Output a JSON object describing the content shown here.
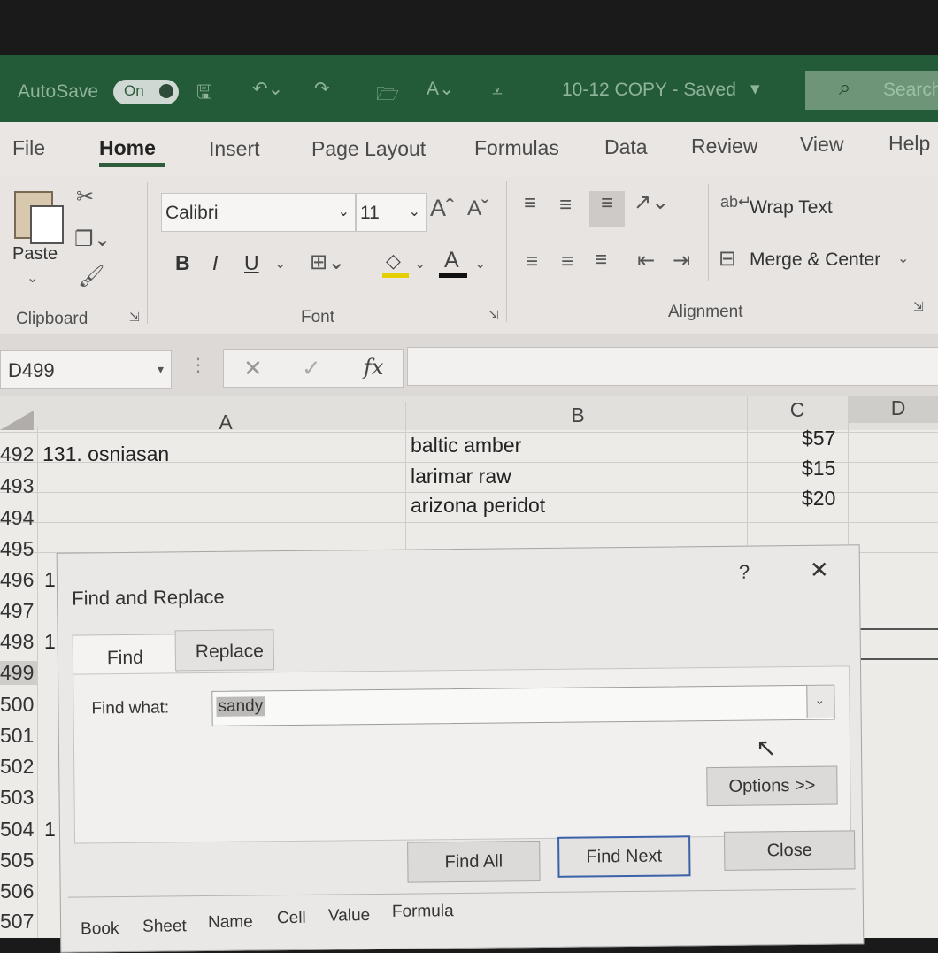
{
  "titlebar": {
    "autosave_label": "AutoSave",
    "autosave_state": "On",
    "doc_title": "10-12 COPY  -  Saved",
    "search_placeholder": "Search"
  },
  "tabs": [
    "File",
    "Home",
    "Insert",
    "Page Layout",
    "Formulas",
    "Data",
    "Review",
    "View",
    "Help"
  ],
  "ribbon": {
    "clipboard_group": "Clipboard",
    "paste_label": "Paste",
    "font_group": "Font",
    "font_name": "Calibri",
    "font_size": "11",
    "bold": "B",
    "italic": "I",
    "underline": "U",
    "alignment_group": "Alignment",
    "wrap_text": "Wrap Text",
    "merge_center": "Merge & Center"
  },
  "formula_bar": {
    "name_box": "D499",
    "fx": "fx"
  },
  "columns": [
    "A",
    "B",
    "C",
    "D"
  ],
  "rows": [
    {
      "num": "492",
      "a": "131. osniasan",
      "b": "baltic amber",
      "c": "$57"
    },
    {
      "num": "493",
      "a": "",
      "b": "larimar raw",
      "c": "$15"
    },
    {
      "num": "494",
      "a": "",
      "b": "arizona peridot",
      "c": "$20"
    },
    {
      "num": "495",
      "a": "",
      "b": "",
      "c": ""
    },
    {
      "num": "496",
      "a": "1",
      "b": "",
      "c": ""
    },
    {
      "num": "497",
      "a": "",
      "b": "",
      "c": ""
    },
    {
      "num": "498",
      "a": "1",
      "b": "",
      "c": ""
    },
    {
      "num": "499",
      "a": "",
      "b": "",
      "c": ""
    },
    {
      "num": "500",
      "a": "",
      "b": "",
      "c": ""
    },
    {
      "num": "501",
      "a": "",
      "b": "",
      "c": ""
    },
    {
      "num": "502",
      "a": "",
      "b": "",
      "c": ""
    },
    {
      "num": "503",
      "a": "",
      "b": "",
      "c": ""
    },
    {
      "num": "504",
      "a": "1",
      "b": "",
      "c": ""
    },
    {
      "num": "505",
      "a": "",
      "b": "",
      "c": ""
    },
    {
      "num": "506",
      "a": "",
      "b": "",
      "c": ""
    },
    {
      "num": "507",
      "a": "",
      "b": "",
      "c": ""
    }
  ],
  "dialog": {
    "title": "Find and Replace",
    "help": "?",
    "close_glyph": "✕",
    "tab_find": "Find",
    "tab_replace": "Replace",
    "find_what_label": "Find what:",
    "find_what_value": "sandy",
    "options_button": "Options >>",
    "find_all_button": "Find All",
    "find_next_button": "Find Next",
    "close_button": "Close",
    "results_headers": [
      "Book",
      "Sheet",
      "Name",
      "Cell",
      "Value",
      "Formula"
    ]
  }
}
